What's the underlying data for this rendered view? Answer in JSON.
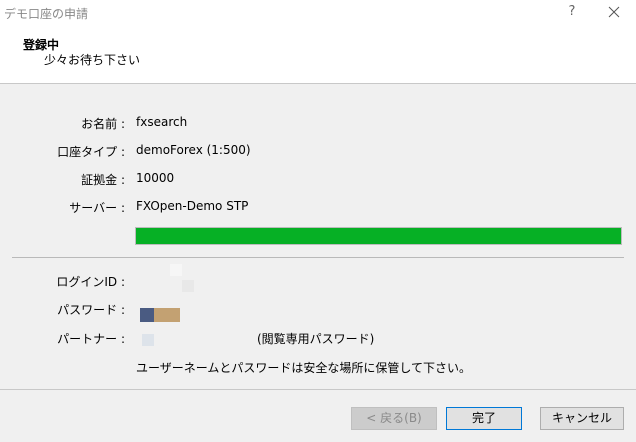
{
  "window": {
    "title": "デモ口座の申請",
    "help_glyph": "?"
  },
  "header": {
    "title": "登録中",
    "subtitle": "少々お待ち下さい"
  },
  "info": [
    {
      "label": "お名前 :",
      "value": "fxsearch"
    },
    {
      "label": "口座タイプ :",
      "value": "demoForex (1:500)"
    },
    {
      "label": "証拠金 :",
      "value": "10000"
    },
    {
      "label": "サーバー :",
      "value": "FXOpen-Demo STP"
    }
  ],
  "progress": {
    "percent": 100,
    "color": "#06b025"
  },
  "credentials": {
    "login_label": "ログインID :",
    "password_label": "パスワード :",
    "partner_label": "パートナー :",
    "readonly_note": "(閲覧専用パスワード)",
    "save_note": "ユーザーネームとパスワードは安全な場所に保管して下さい。"
  },
  "buttons": {
    "back": "< 戻る(B)",
    "finish": "完了",
    "cancel": "キャンセル"
  }
}
